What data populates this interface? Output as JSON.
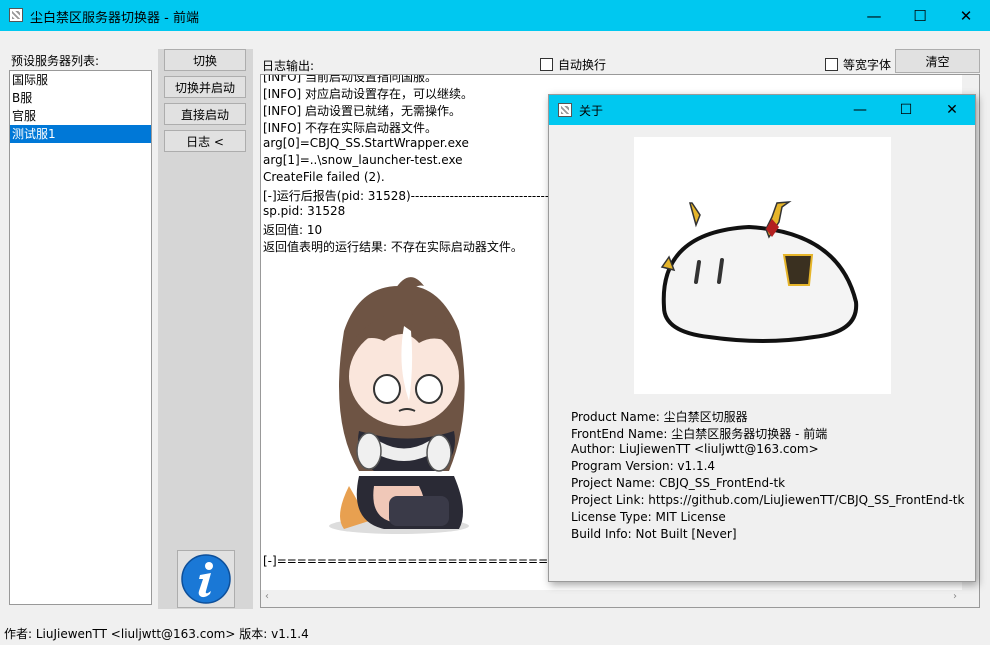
{
  "window": {
    "title": "尘白禁区服务器切换器 - 前端",
    "minimize_glyph": "—",
    "maximize_glyph": "☐",
    "close_glyph": "✕"
  },
  "server_list": {
    "label": "预设服务器列表:",
    "items": [
      "国际服",
      "B服",
      "官服",
      "测试服1"
    ],
    "selected_index": 3
  },
  "buttons": {
    "switch": "切换",
    "switch_and_launch": "切换并启动",
    "launch_direct": "直接启动",
    "log": "日志 <"
  },
  "log": {
    "label": "日志输出:",
    "auto_wrap_label": "自动换行",
    "monospace_label": "等宽字体",
    "clear_label": "清空",
    "lines": [
      "[INFO] 当前启动设置指向国服。",
      "[INFO] 对应启动设置存在，可以继续。",
      "[INFO] 启动设置已就绪，无需操作。",
      "[INFO] 不存在实际启动器文件。",
      "arg[0]=CBJQ_SS.StartWrapper.exe",
      "arg[1]=..\\snow_launcher-test.exe",
      "CreateFile failed (2).",
      "[-]运行后报告(pid: 31528)------------------------------------------------------------",
      "sp.pid: 31528",
      "返回值: 10",
      "返回值表明的运行结果: 不存在实际启动器文件。"
    ],
    "footer_line": "[-]================================================================================"
  },
  "status_bar": {
    "text": "作者: LiuJiewenTT <liuljwtt@163.com> 版本: v1.1.4"
  },
  "about": {
    "title": "关于",
    "lines": [
      "Product Name: 尘白禁区切服器",
      "FrontEnd Name: 尘白禁区服务器切换器 - 前端",
      "Author: LiuJiewenTT <liuljwtt@163.com>",
      "Program Version: v1.1.4",
      "Project Name: CBJQ_SS_FrontEnd-tk",
      "Project Link: https://github.com/LiuJiewenTT/CBJQ_SS_FrontEnd-tk",
      "License Type: MIT License",
      "Build Info: Not Built [Never]"
    ]
  },
  "colors": {
    "titlebar": "#00c8f0",
    "selection": "#0078d7",
    "info_button": "#1a78d6"
  },
  "icons": {
    "app": "app-icon",
    "info": "info-icon",
    "mascot": "chibi-character",
    "logo": "white-blob-mascot"
  }
}
